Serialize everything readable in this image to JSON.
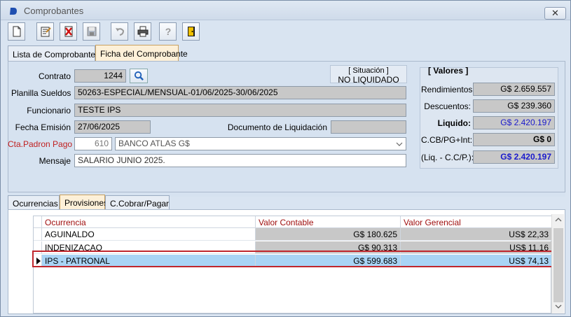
{
  "window": {
    "title": "Comprobantes",
    "close_glyph": "✕"
  },
  "toolbar": {
    "buttons": [
      {
        "name": "new-document-icon"
      },
      {
        "name": "edit-icon"
      },
      {
        "name": "delete-icon"
      },
      {
        "name": "save-icon"
      },
      {
        "name": "undo-icon"
      },
      {
        "name": "print-icon"
      },
      {
        "name": "help-icon"
      },
      {
        "name": "exit-icon"
      }
    ]
  },
  "tabs": {
    "list": "Lista de Comprobantes",
    "detail": "Ficha del Comprobante"
  },
  "form": {
    "contrato_label": "Contrato",
    "contrato_value": "1244",
    "planilla_label": "Planilla Sueldos",
    "planilla_value": "50263-ESPECIAL/MENSUAL-01/06/2025-30/06/2025",
    "funcionario_label": "Funcionario",
    "funcionario_value": "TESTE IPS",
    "fecha_label": "Fecha Emisión",
    "fecha_value": "27/06/2025",
    "doc_liq_label": "Documento de Liquidación",
    "doc_liq_value": "",
    "cta_label": "Cta.Padron Pago",
    "cta_code": "610",
    "cta_value": "BANCO ATLAS G$",
    "mensaje_label": "Mensaje",
    "mensaje_value": "SALARIO JUNIO 2025."
  },
  "situacion": {
    "label": "[ Situación ]",
    "value": "NO LIQUIDADO"
  },
  "valores": {
    "title": "[ Valores ]",
    "rendimientos_label": "Rendimientos:",
    "rendimientos_value": "G$ 2.659.557",
    "descuentos_label": "Descuentos:",
    "descuentos_value": "G$ 239.360",
    "liquido_label": "Liquido:",
    "liquido_value": "G$ 2.420.197",
    "ccb_label": "C.CB/PG+Int:",
    "ccb_value": "G$ 0",
    "liq_cc_label": "(Liq. - C.C/P.):",
    "liq_cc_value": "G$ 2.420.197"
  },
  "subtabs": {
    "ocurrencias": "Ocurrencias",
    "provisiones": "Provisiones",
    "ccobrar": "C.Cobrar/Pagar"
  },
  "grid": {
    "headers": [
      "Ocurrencia",
      "Valor Contable",
      "Valor Gerencial"
    ],
    "rows": [
      {
        "ocurrencia": "AGUINALDO",
        "contable": "G$ 180.625",
        "gerencial": "US$ 22,33"
      },
      {
        "ocurrencia": "INDENIZACAO",
        "contable": "G$ 90.313",
        "gerencial": "US$ 11,16"
      },
      {
        "ocurrencia": "IPS - PATRONAL",
        "contable": "G$ 599.683",
        "gerencial": "US$ 74,13"
      }
    ],
    "selected_index": 2
  },
  "colors": {
    "accent_blue": "#1a1acc",
    "required_label": "#c02020",
    "selection_outline": "#c0262d"
  }
}
